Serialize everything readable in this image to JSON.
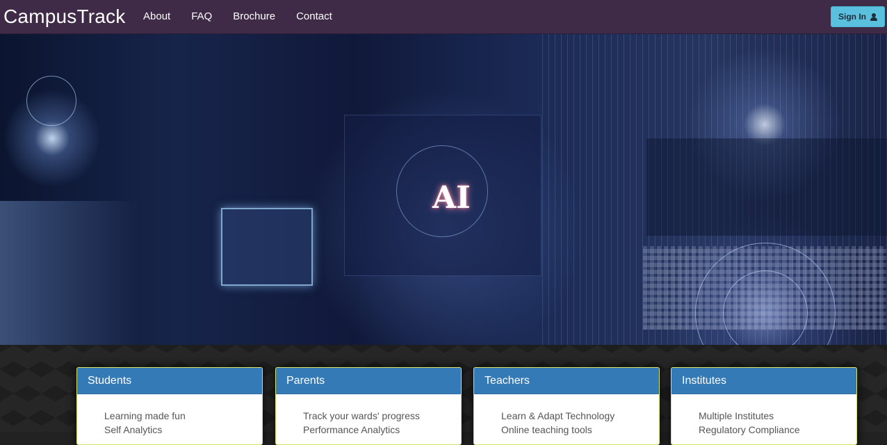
{
  "navbar": {
    "brand": "CampusTrack",
    "links": [
      "About",
      "FAQ",
      "Brochure",
      "Contact"
    ],
    "signin_label": "Sign In"
  },
  "hero": {
    "ai_text": "AI"
  },
  "cards": [
    {
      "title": "Students",
      "items": [
        "Learning made fun",
        "Self Analytics"
      ]
    },
    {
      "title": "Parents",
      "items": [
        "Track your wards' progress",
        "Performance Analytics"
      ]
    },
    {
      "title": "Teachers",
      "items": [
        "Learn & Adapt Technology",
        "Online teaching tools"
      ]
    },
    {
      "title": "Institutes",
      "items": [
        "Multiple Institutes",
        "Regulatory Compliance"
      ]
    }
  ],
  "colors": {
    "navbar_bg": "#3f2a47",
    "signin_bg": "#5bc0de",
    "card_header_bg": "#337ab7",
    "card_border": "#d6e36a"
  },
  "icons": {
    "signin": "user-icon"
  }
}
